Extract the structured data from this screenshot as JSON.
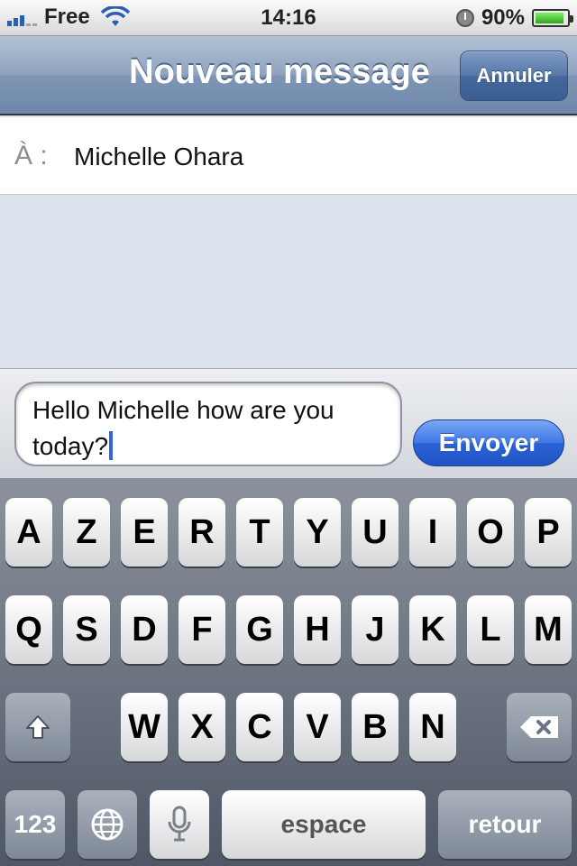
{
  "status_bar": {
    "carrier": "Free",
    "time": "14:16",
    "battery": "90%",
    "battery_level": 0.9,
    "icons": [
      "signal-icon",
      "wifi-icon",
      "alarm-icon",
      "battery-icon"
    ]
  },
  "nav": {
    "title": "Nouveau message",
    "cancel_label": "Annuler"
  },
  "recipient": {
    "label": "À :",
    "value": "Michelle Ohara"
  },
  "compose": {
    "text": "Hello Michelle how are you today?",
    "send_label": "Envoyer"
  },
  "keyboard": {
    "row1": [
      "A",
      "Z",
      "E",
      "R",
      "T",
      "Y",
      "U",
      "I",
      "O",
      "P"
    ],
    "row2": [
      "Q",
      "S",
      "D",
      "F",
      "G",
      "H",
      "J",
      "K",
      "L",
      "M"
    ],
    "row3": [
      "W",
      "X",
      "C",
      "V",
      "B",
      "N"
    ],
    "numbers_label": "123",
    "space_label": "espace",
    "return_label": "retour",
    "icons": [
      "shift-icon",
      "backspace-icon",
      "globe-icon",
      "microphone-icon"
    ]
  },
  "colors": {
    "nav_accent": "#6e87a9",
    "send_button": "#2a62d6",
    "caret": "#2f66d6"
  }
}
